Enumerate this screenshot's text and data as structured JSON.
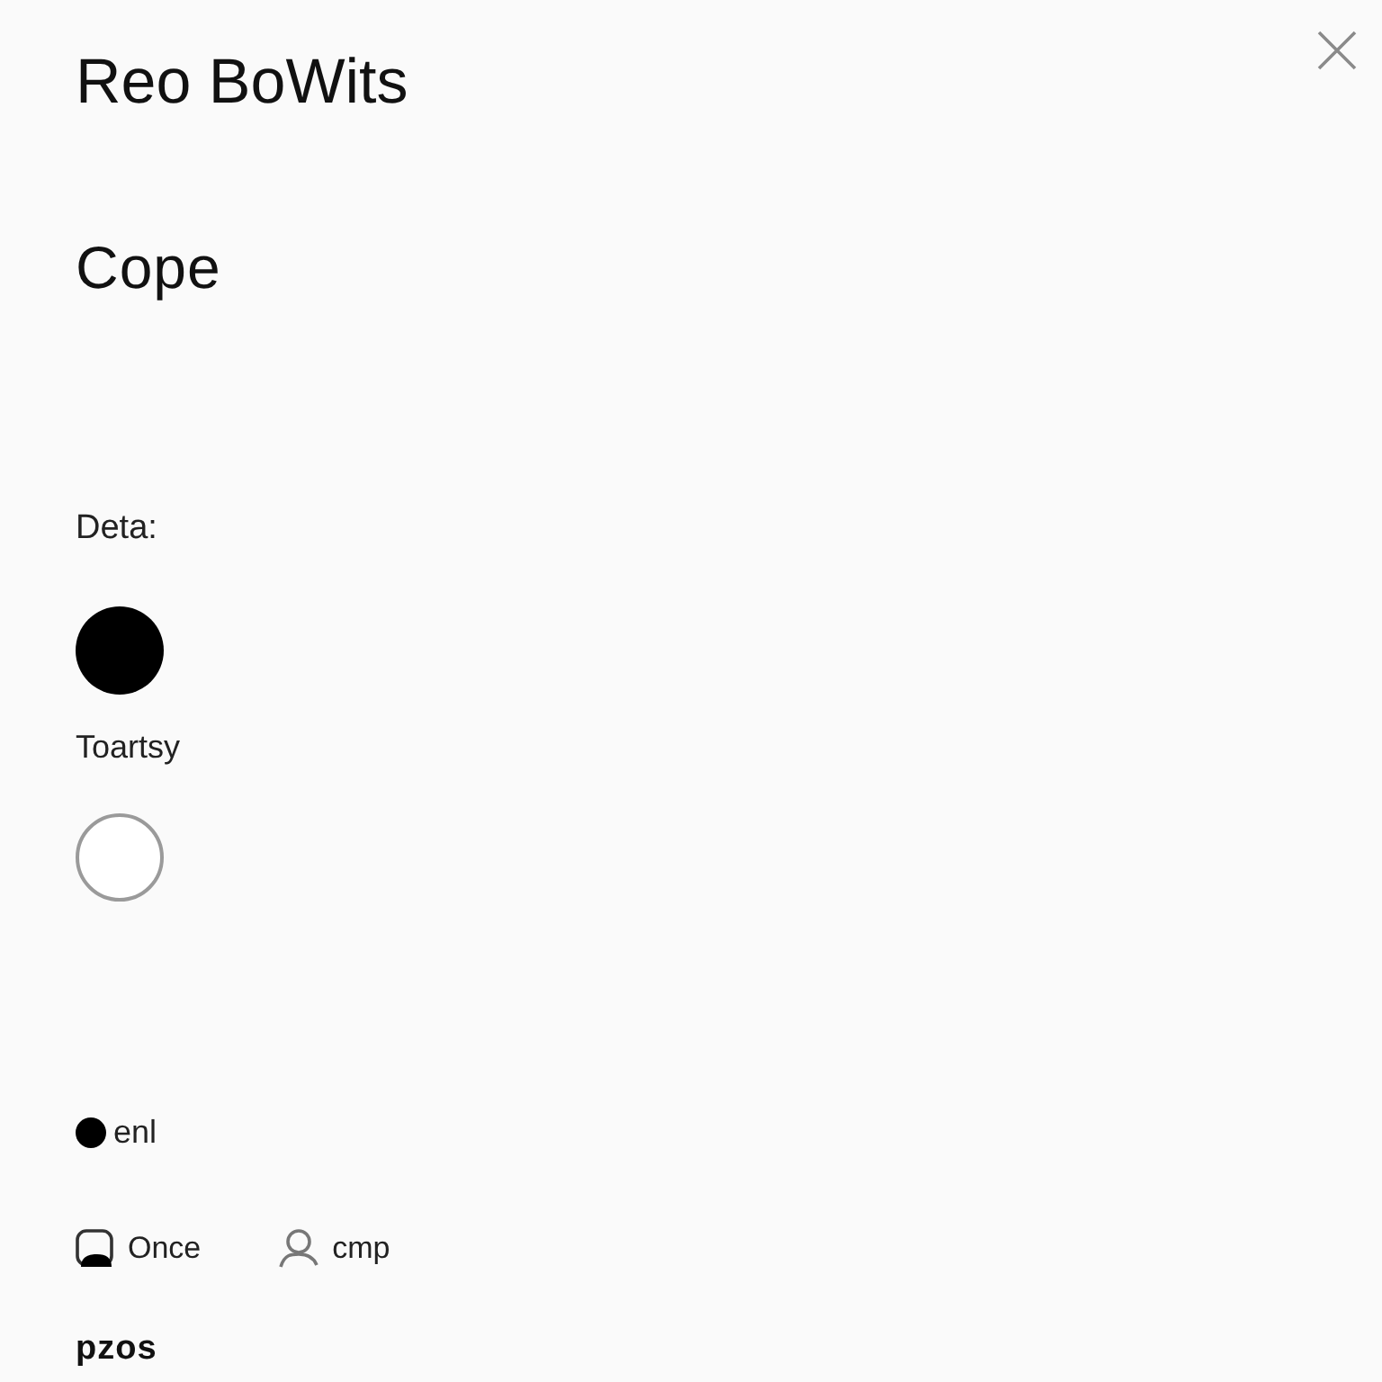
{
  "window": {
    "title": "Reo BoWits"
  },
  "heading": "Cope",
  "choices": [
    {
      "label": "Deta:",
      "selected": true
    },
    {
      "label": "Toartsy",
      "selected": false
    }
  ],
  "status": {
    "label": "enl"
  },
  "options": [
    {
      "label": "Once",
      "kind": "card"
    },
    {
      "label": "cmp",
      "kind": "person"
    }
  ],
  "footer": "pzos"
}
